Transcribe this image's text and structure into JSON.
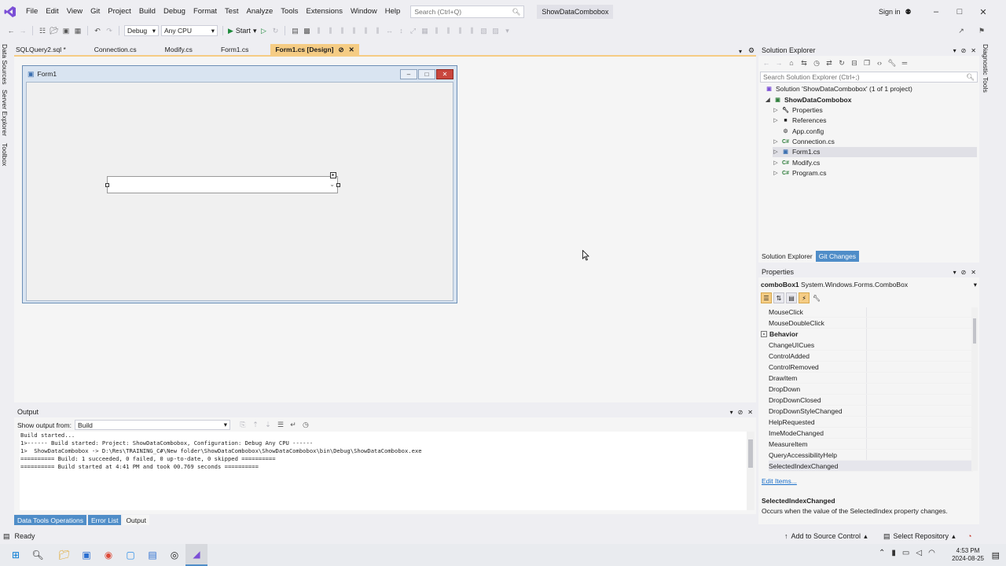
{
  "menu": [
    "File",
    "Edit",
    "View",
    "Git",
    "Project",
    "Build",
    "Debug",
    "Format",
    "Test",
    "Analyze",
    "Tools",
    "Extensions",
    "Window",
    "Help"
  ],
  "search": {
    "placeholder": "Search (Ctrl+Q)"
  },
  "solution_title": "ShowDataCombobox",
  "signin": "Sign in",
  "toolbar": {
    "config": "Debug",
    "platform": "Any CPU",
    "start": "Start"
  },
  "left_tabs": [
    "Data Sources",
    "Server Explorer",
    "Toolbox"
  ],
  "right_tab": "Diagnostic Tools",
  "doc_tabs": [
    {
      "label": "SQLQuery2.sql *",
      "active": false
    },
    {
      "label": "Connection.cs",
      "active": false
    },
    {
      "label": "Modify.cs",
      "active": false
    },
    {
      "label": "Form1.cs",
      "active": false
    },
    {
      "label": "Form1.cs [Design]",
      "active": true
    }
  ],
  "form": {
    "title": "Form1"
  },
  "solution_explorer": {
    "title": "Solution Explorer",
    "search_placeholder": "Search Solution Explorer (Ctrl+;)",
    "solution": "Solution 'ShowDataCombobox' (1 of 1 project)",
    "project": "ShowDataCombobox",
    "items": [
      {
        "label": "Properties",
        "icon": "wrench-icon",
        "expandable": true
      },
      {
        "label": "References",
        "icon": "references-icon",
        "expandable": true
      },
      {
        "label": "App.config",
        "icon": "config-file-icon",
        "expandable": false
      },
      {
        "label": "Connection.cs",
        "icon": "csharp-file-icon",
        "expandable": true
      },
      {
        "label": "Form1.cs",
        "icon": "form-icon",
        "expandable": true,
        "selected": true
      },
      {
        "label": "Modify.cs",
        "icon": "csharp-file-icon",
        "expandable": true
      },
      {
        "label": "Program.cs",
        "icon": "csharp-file-icon",
        "expandable": true
      }
    ],
    "bottom_tabs": [
      "Solution Explorer",
      "Git Changes"
    ]
  },
  "properties": {
    "title": "Properties",
    "object_name": "comboBox1",
    "object_type": "System.Windows.Forms.ComboBox",
    "rows_before": [
      "MouseClick",
      "MouseDoubleClick"
    ],
    "category": "Behavior",
    "rows": [
      "ChangeUICues",
      "ControlAdded",
      "ControlRemoved",
      "DrawItem",
      "DropDown",
      "DropDownClosed",
      "DropDownStyleChanged",
      "HelpRequested",
      "ImeModeChanged",
      "MeasureItem",
      "QueryAccessibilityHelp",
      "SelectedIndexChanged"
    ],
    "edit_items": "Edit Items...",
    "desc_title": "SelectedIndexChanged",
    "desc_text": "Occurs when the value of the SelectedIndex property changes."
  },
  "output": {
    "title": "Output",
    "show_from_label": "Show output from:",
    "source": "Build",
    "lines": [
      "Build started...",
      "1>------ Build started: Project: ShowDataCombobox, Configuration: Debug Any CPU ------",
      "1>  ShowDataCombobox -> D:\\Res\\TRAINING_C#\\New folder\\ShowDataCombobox\\ShowDataCombobox\\bin\\Debug\\ShowDataCombobox.exe",
      "========== Build: 1 succeeded, 0 failed, 0 up-to-date, 0 skipped ==========",
      "========== Build started at 4:41 PM and took 00.769 seconds =========="
    ]
  },
  "bottom_tabs": [
    "Data Tools Operations",
    "Error List",
    "Output"
  ],
  "status": {
    "ready": "Ready",
    "add_source": "Add to Source Control",
    "select_repo": "Select Repository"
  },
  "clock": {
    "time": "4:53 PM",
    "date": "2024-08-25"
  },
  "colors": {
    "accent": "#f5cc84",
    "vs_purple": "#7b4fd6",
    "blue_tab": "#4f8dc8"
  }
}
